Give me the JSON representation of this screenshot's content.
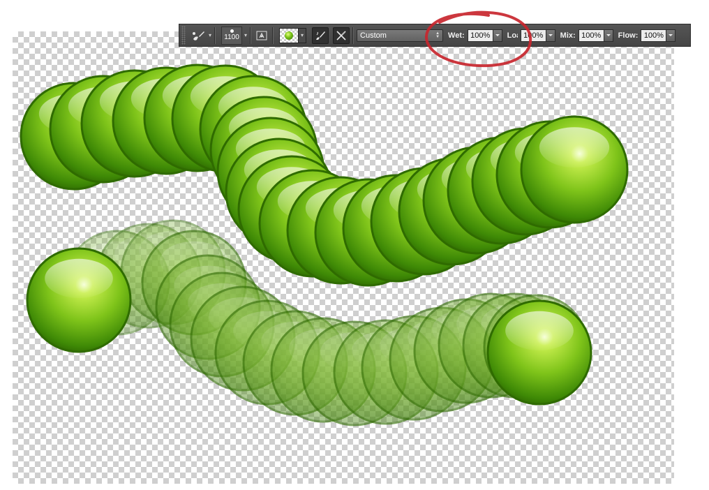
{
  "options_bar": {
    "brush_size": "1100",
    "mixer_combo": "Custom",
    "wet_label": "Wet:",
    "wet_value": "100%",
    "load_label": "Load:",
    "load_value": "100%",
    "mix_label": "Mix:",
    "mix_value": "100%",
    "flow_label": "Flow:",
    "flow_value": "100%",
    "icons": [
      "mixer-brush-tool-icon",
      "brush-panel-icon",
      "current-brush-load-swatch",
      "load-brush-after-stroke-icon",
      "clean-brush-after-stroke-icon"
    ]
  },
  "colors": {
    "toolbar_bg": "#4a4a4a",
    "highlight_circle": "#c8262e",
    "stroke_green": "#6fb51a",
    "stroke_dark": "#2f6b00"
  }
}
